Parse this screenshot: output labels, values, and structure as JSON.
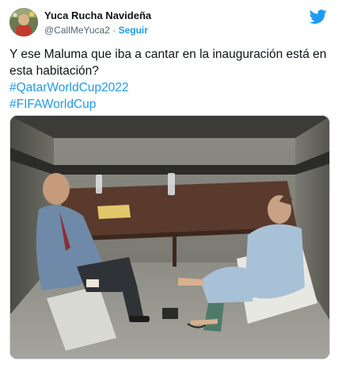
{
  "tweet": {
    "author": {
      "display_name": "Yuca Rucha Navideña",
      "handle": "@CallMeYuca2",
      "separator": "·",
      "follow_label": "Seguir"
    },
    "text_lines": [
      "Y ese Maluma que iba a cantar en la inauguración está en",
      "esta habitación?"
    ],
    "hashtags": [
      "#QatarWorldCup2022",
      "#FIFAWorldCup"
    ],
    "brand_icon": "twitter-bird-icon",
    "colors": {
      "accent": "#1d9bf0",
      "text": "#0f1419",
      "secondary": "#536471"
    }
  }
}
